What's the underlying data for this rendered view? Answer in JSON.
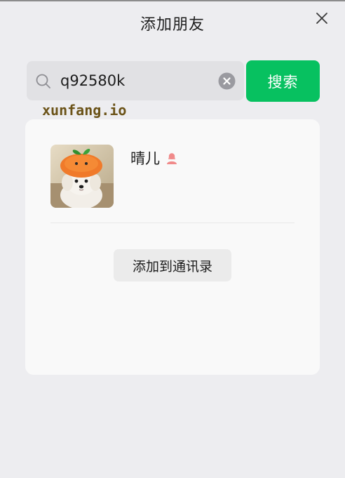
{
  "window": {
    "title": "添加朋友"
  },
  "search": {
    "query": "q92580k",
    "button_label": "搜索",
    "search_icon": "search-icon",
    "clear_icon": "clear-circle-icon"
  },
  "watermark": {
    "text": "xunfang.io"
  },
  "result": {
    "name": "晴儿",
    "gender_icon": "female-icon",
    "avatar": "dog-with-orange-hat-photo",
    "add_button_label": "添加到通讯录"
  },
  "colors": {
    "accent": "#07C160",
    "background": "#EDEDF0",
    "card": "#F9F9F9",
    "female_icon": "#F08A8A"
  }
}
